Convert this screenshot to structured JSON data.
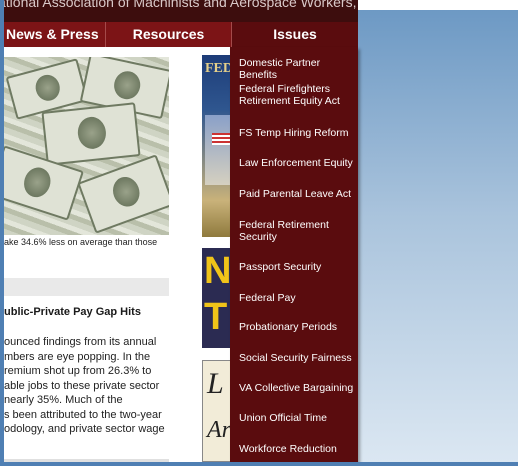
{
  "header": {
    "org_name": "ational Association of Machinists and Aerospace Workers, AFL-CIO"
  },
  "nav": {
    "news": "News & Press",
    "resources": "Resources",
    "issues": "Issues"
  },
  "issues_menu": [
    "Domestic Partner Benefits",
    "Federal Firefighters Retirement Equity Act",
    "FS Temp Hiring Reform",
    "Law Enforcement Equity",
    "Paid Parental Leave Act",
    "Federal Retirement Security",
    "Passport Security",
    "Federal Pay",
    "Probationary Periods",
    "Social Security Fairness",
    "VA Collective Bargaining",
    "Union Official Time",
    "Workforce Reduction"
  ],
  "main": {
    "caption": "ake 34.6% less on average than those",
    "article_title": "ublic-Private Pay Gap Hits",
    "article_lines": [
      "ounced findings from its annual",
      "mbers are eye popping. In the",
      "remium shot up from 26.3% to",
      "able jobs to these private sector",
      " nearly 35%. Much of the",
      "s been attributed to the two-year",
      "odology, and private sector wage"
    ]
  },
  "thumbnails": {
    "fed": "FED",
    "ntw": "N",
    "ntw2": "T",
    "la": "L",
    "la2": "Ar"
  },
  "colors": {
    "nav_bg": "#7c1416",
    "dropdown_bg": "#5a0c0e",
    "frame": "#4f7fb3"
  }
}
